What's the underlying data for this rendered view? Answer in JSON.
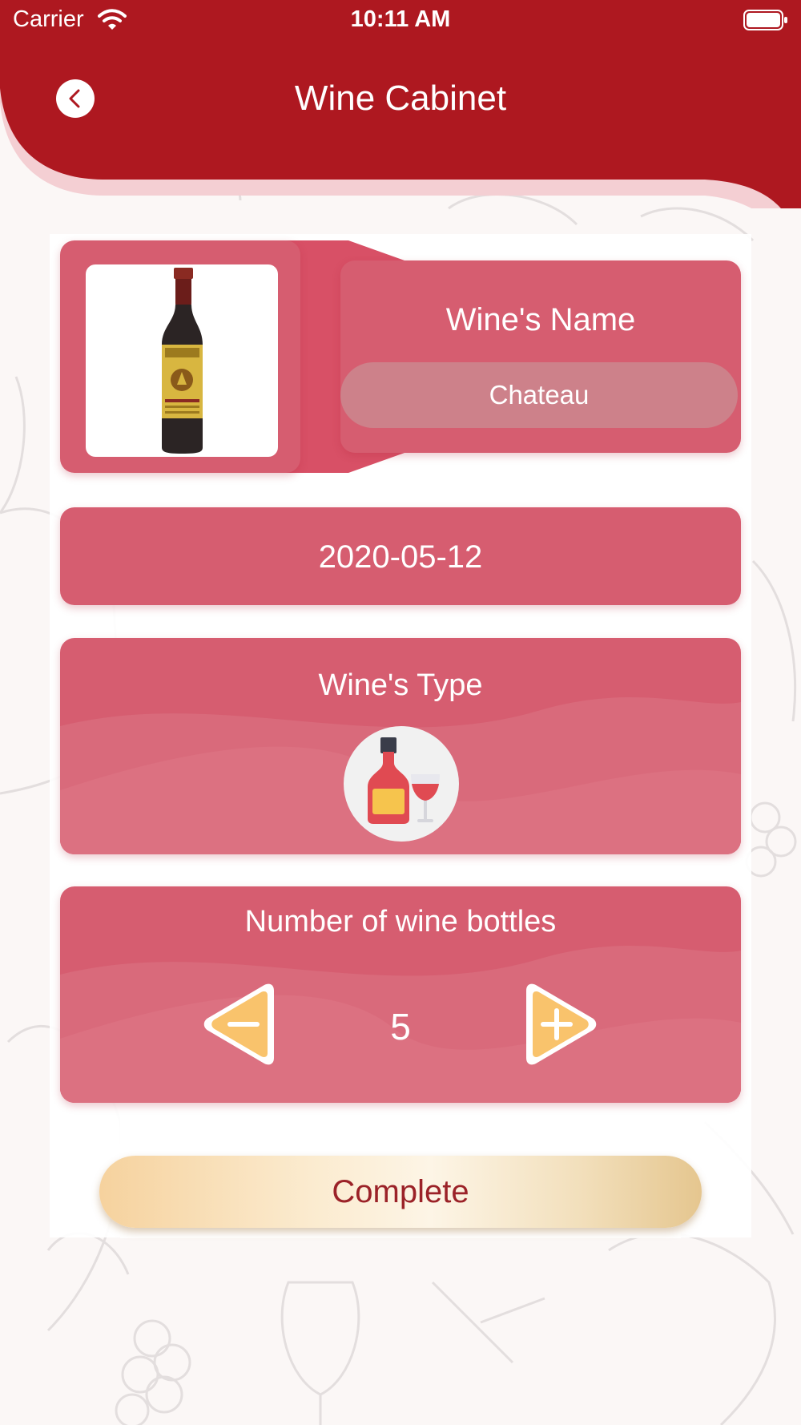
{
  "status_bar": {
    "carrier": "Carrier",
    "time": "10:11 AM"
  },
  "header": {
    "title": "Wine Cabinet",
    "back_icon": "chevron-left-icon"
  },
  "wine_name": {
    "label": "Wine's Name",
    "value": "Chateau"
  },
  "date": {
    "value": "2020-05-12"
  },
  "wine_type": {
    "label": "Wine's Type",
    "icon": "wine-bottle-glass-icon"
  },
  "bottles": {
    "label": "Number of wine bottles",
    "count": "5",
    "minus_icon": "minus-icon",
    "plus_icon": "plus-icon"
  },
  "actions": {
    "complete_label": "Complete"
  },
  "colors": {
    "header": "#ae1820",
    "card": "#d65d70",
    "input": "#cd818a",
    "button_text": "#9b2228",
    "stepper_fill": "#f9c36c"
  }
}
